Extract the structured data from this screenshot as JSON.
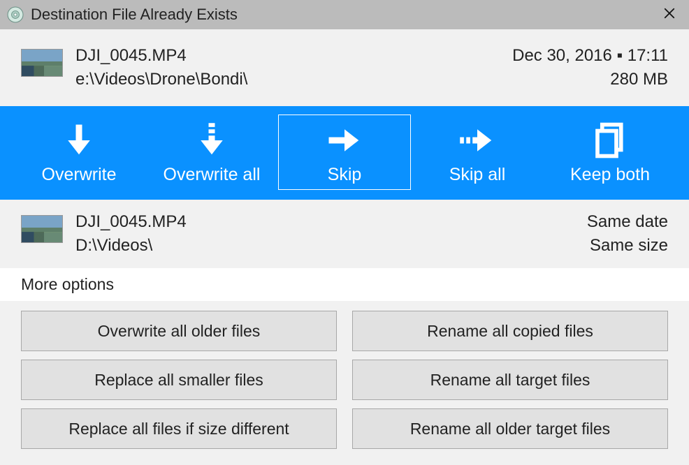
{
  "title": "Destination File Already Exists",
  "source": {
    "filename": "DJI_0045.MP4",
    "path": "e:\\Videos\\Drone\\Bondi\\",
    "datetime": "Dec 30, 2016 ▪ 17:11",
    "size": "280 MB"
  },
  "destination": {
    "filename": "DJI_0045.MP4",
    "path": "D:\\Videos\\",
    "date_status": "Same date",
    "size_status": "Same size"
  },
  "actions": {
    "overwrite": "Overwrite",
    "overwrite_all": "Overwrite all",
    "skip": "Skip",
    "skip_all": "Skip all",
    "keep_both": "Keep both"
  },
  "more_options_label": "More options",
  "options": {
    "overwrite_older": "Overwrite all older files",
    "rename_copied": "Rename all copied files",
    "replace_smaller": "Replace all smaller files",
    "rename_target": "Rename all target files",
    "replace_diff_size": "Replace all files if size different",
    "rename_older_target": "Rename all older target files"
  }
}
